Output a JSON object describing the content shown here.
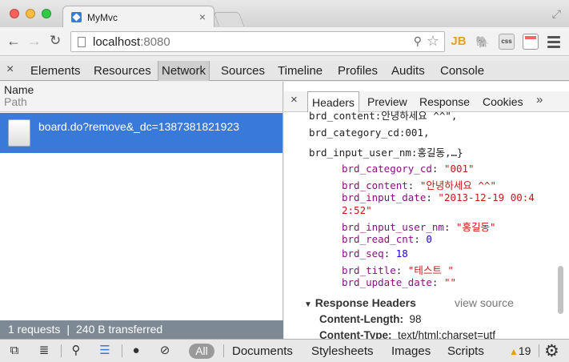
{
  "window": {
    "tab_title": "MyMvc",
    "tab_close": "×",
    "fullscreen_glyph": "⤢"
  },
  "toolbar": {
    "back_glyph": "←",
    "forward_glyph": "→",
    "reload_glyph": "↻",
    "url_host": "localhost",
    "url_port": ":8080",
    "zoom_glyph": "⚲",
    "star_glyph": "☆",
    "extensions": [
      "JB",
      "evernote-icon",
      "css",
      "window-icon"
    ],
    "ext_jb_label": "JB",
    "ext_css_label": "css"
  },
  "devtools": {
    "close_glyph": "×",
    "tabs": [
      "Elements",
      "Resources",
      "Network",
      "Sources",
      "Timeline",
      "Profiles",
      "Audits",
      "Console"
    ],
    "active_tab": "Network"
  },
  "network": {
    "col_name": "Name",
    "col_path": "Path",
    "request_name": "board.do?remove&_dc=1387381821923",
    "status_requests": "1 requests",
    "status_sep": "|",
    "status_transferred": "240 B transferred"
  },
  "detail": {
    "close_glyph": "×",
    "tabs": [
      "Headers",
      "Preview",
      "Response",
      "Cookies"
    ],
    "active_tab": "Headers",
    "more_glyph": "»",
    "cut_line": "brd_content:안녕하세요 ^^\",",
    "summary_line1": "brd_category_cd:001,",
    "summary_line2": "brd_input_user_nm:홍길동,…}",
    "fields": [
      {
        "key": "brd_category_cd",
        "value": "\"001\"",
        "type": "str"
      },
      {
        "key": "brd_content",
        "value": "\"안녕하세요 ^^\"",
        "type": "str"
      },
      {
        "key": "brd_input_date",
        "value": "\"2013-12-19 00:4",
        "type": "str"
      },
      {
        "key": "",
        "value": "2:52\"",
        "type": "str"
      },
      {
        "key": "brd_input_user_nm",
        "value": "\"홍길동\"",
        "type": "str"
      },
      {
        "key": "brd_read_cnt",
        "value": "0",
        "type": "num"
      },
      {
        "key": "brd_seq",
        "value": "18",
        "type": "num"
      },
      {
        "key": "brd_title",
        "value": "\"테스트 \"",
        "type": "str"
      },
      {
        "key": "brd_update_date",
        "value": "\"\"",
        "type": "str"
      }
    ],
    "response_headers_label": "Response Headers",
    "view_source": "view source",
    "content_length_key": "Content-Length:",
    "content_length_val": "98",
    "content_type_key": "Content-Type:",
    "content_type_val": "text/html;charset=utf"
  },
  "bottom_bar": {
    "all_label": "All",
    "filters": [
      "Documents",
      "Stylesheets",
      "Images",
      "Scripts"
    ],
    "warning_count": "19"
  }
}
